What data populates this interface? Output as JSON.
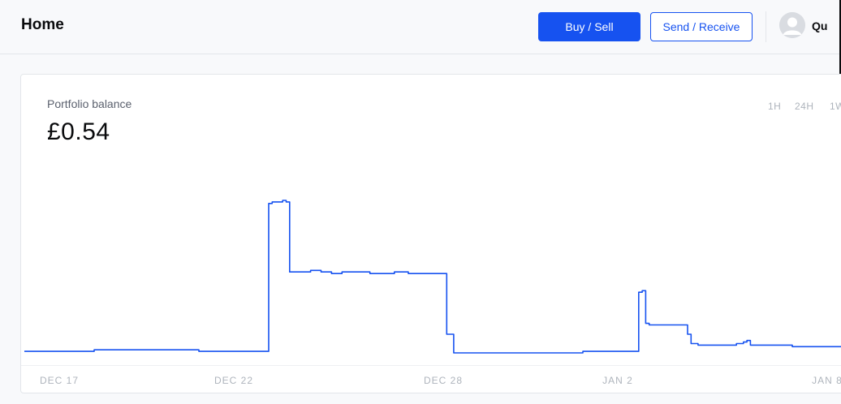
{
  "header": {
    "title": "Home",
    "buy_sell_label": "Buy / Sell",
    "send_receive_label": "Send / Receive",
    "user_name": "Qu"
  },
  "portfolio": {
    "label": "Portfolio balance",
    "balance": "£0.54",
    "ranges": [
      "1H",
      "24H",
      "1W"
    ]
  },
  "colors": {
    "accent": "#1652f0",
    "line": "#1652f0",
    "muted": "#aeb4bc"
  },
  "chart_data": {
    "type": "line",
    "x_tick_labels": [
      "DEC 17",
      "DEC 22",
      "DEC 28",
      "JAN 2",
      "JAN 8"
    ],
    "x_tick_days": [
      0,
      5,
      11,
      16,
      22
    ],
    "ylim": [
      0,
      1
    ],
    "grid": false,
    "series": [
      {
        "values_x_days": [
          -1.0,
          0.0,
          1.0,
          2.0,
          3.0,
          4.0,
          5.0,
          5.8,
          6.0,
          6.1,
          6.4,
          6.5,
          6.6,
          6.8,
          7.2,
          7.5,
          7.8,
          8.1,
          8.5,
          8.9,
          9.2,
          9.6,
          10.0,
          10.3,
          10.6,
          10.8,
          11.0,
          11.1,
          11.2,
          11.3,
          11.6,
          12.0,
          13.0,
          14.0,
          15.0,
          16.0,
          16.4,
          16.6,
          16.7,
          16.8,
          16.9,
          17.2,
          17.6,
          17.9,
          18.0,
          18.1,
          18.3,
          18.4,
          18.7,
          19.0,
          19.4,
          19.6,
          19.7,
          19.8,
          20.1,
          20.5,
          21.0,
          21.5,
          22.0,
          22.5,
          23.0,
          23.5
        ],
        "values_y": [
          0.01,
          0.01,
          0.02,
          0.02,
          0.02,
          0.01,
          0.01,
          0.01,
          0.96,
          0.97,
          0.98,
          0.97,
          0.52,
          0.52,
          0.53,
          0.52,
          0.51,
          0.52,
          0.52,
          0.51,
          0.51,
          0.52,
          0.51,
          0.51,
          0.51,
          0.51,
          0.51,
          0.12,
          0.12,
          0.0,
          0.0,
          0.0,
          0.0,
          0.0,
          0.01,
          0.01,
          0.01,
          0.39,
          0.4,
          0.19,
          0.18,
          0.18,
          0.18,
          0.18,
          0.12,
          0.06,
          0.05,
          0.05,
          0.05,
          0.05,
          0.06,
          0.07,
          0.08,
          0.05,
          0.05,
          0.05,
          0.04,
          0.04,
          0.04,
          0.03,
          0.03,
          0.03
        ]
      }
    ]
  }
}
